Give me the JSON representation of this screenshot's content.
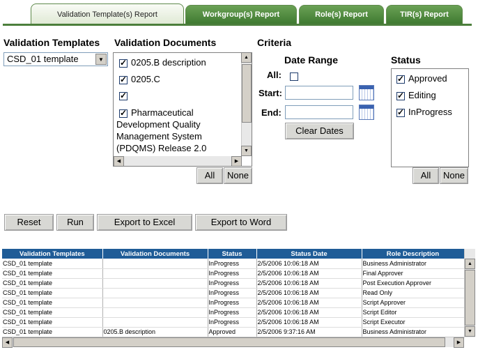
{
  "tabs": [
    {
      "label": "Validation Template(s) Report",
      "active": true
    },
    {
      "label": "Workgroup(s) Report",
      "active": false
    },
    {
      "label": "Role(s) Report",
      "active": false
    },
    {
      "label": "TIR(s) Report",
      "active": false
    }
  ],
  "validation_templates": {
    "title": "Validation Templates",
    "selected": "CSD_01 template"
  },
  "validation_documents": {
    "title": "Validation Documents",
    "items": [
      {
        "label": "0205.B description",
        "checked": true
      },
      {
        "label": "0205.C",
        "checked": true
      },
      {
        "label": "",
        "checked": true
      },
      {
        "label": "Pharmaceutical",
        "checked": true
      },
      {
        "label": "Development Quality"
      },
      {
        "label": "Management System"
      },
      {
        "label": "(PDQMS) Release 2.0"
      }
    ],
    "all_label": "All",
    "none_label": "None"
  },
  "criteria": {
    "title": "Criteria",
    "date_range_title": "Date Range",
    "all_label": "All:",
    "all_checked": false,
    "start_label": "Start:",
    "start_value": "",
    "end_label": "End:",
    "end_value": "",
    "clear_dates_label": "Clear Dates"
  },
  "status": {
    "title": "Status",
    "items": [
      {
        "label": "Approved",
        "checked": true
      },
      {
        "label": "Editing",
        "checked": true
      },
      {
        "label": "InProgress",
        "checked": true
      }
    ],
    "all_label": "All",
    "none_label": "None"
  },
  "actions": {
    "reset": "Reset",
    "run": "Run",
    "export_excel": "Export to Excel",
    "export_word": "Export to Word"
  },
  "grid": {
    "columns": [
      "Validation Templates",
      "Validation Documents",
      "Status",
      "Status Date",
      "Role Description"
    ],
    "rows": [
      [
        "CSD_01 template",
        "",
        "InProgress",
        "2/5/2006 10:06:18 AM",
        "Business Administrator"
      ],
      [
        "CSD_01 template",
        "",
        "InProgress",
        "2/5/2006 10:06:18 AM",
        "Final Approver"
      ],
      [
        "CSD_01 template",
        "",
        "InProgress",
        "2/5/2006 10:06:18 AM",
        "Post Execution Approver"
      ],
      [
        "CSD_01 template",
        "",
        "InProgress",
        "2/5/2006 10:06:18 AM",
        "Read Only"
      ],
      [
        "CSD_01 template",
        "",
        "InProgress",
        "2/5/2006 10:06:18 AM",
        "Script Approver"
      ],
      [
        "CSD_01 template",
        "",
        "InProgress",
        "2/5/2006 10:06:18 AM",
        "Script Editor"
      ],
      [
        "CSD_01 template",
        "",
        "InProgress",
        "2/5/2006 10:06:18 AM",
        "Script Executor"
      ],
      [
        "CSD_01 template",
        "0205.B description",
        "Approved",
        "2/5/2006 9:37:16 AM",
        "Business Administrator"
      ]
    ]
  },
  "colors": {
    "tab_green": "#3f7a31",
    "grid_header": "#1f5c97"
  },
  "icons": [
    "dropdown-arrow-icon",
    "calendar-icon",
    "scroll-up-icon",
    "scroll-down-icon",
    "scroll-left-icon",
    "scroll-right-icon"
  ]
}
